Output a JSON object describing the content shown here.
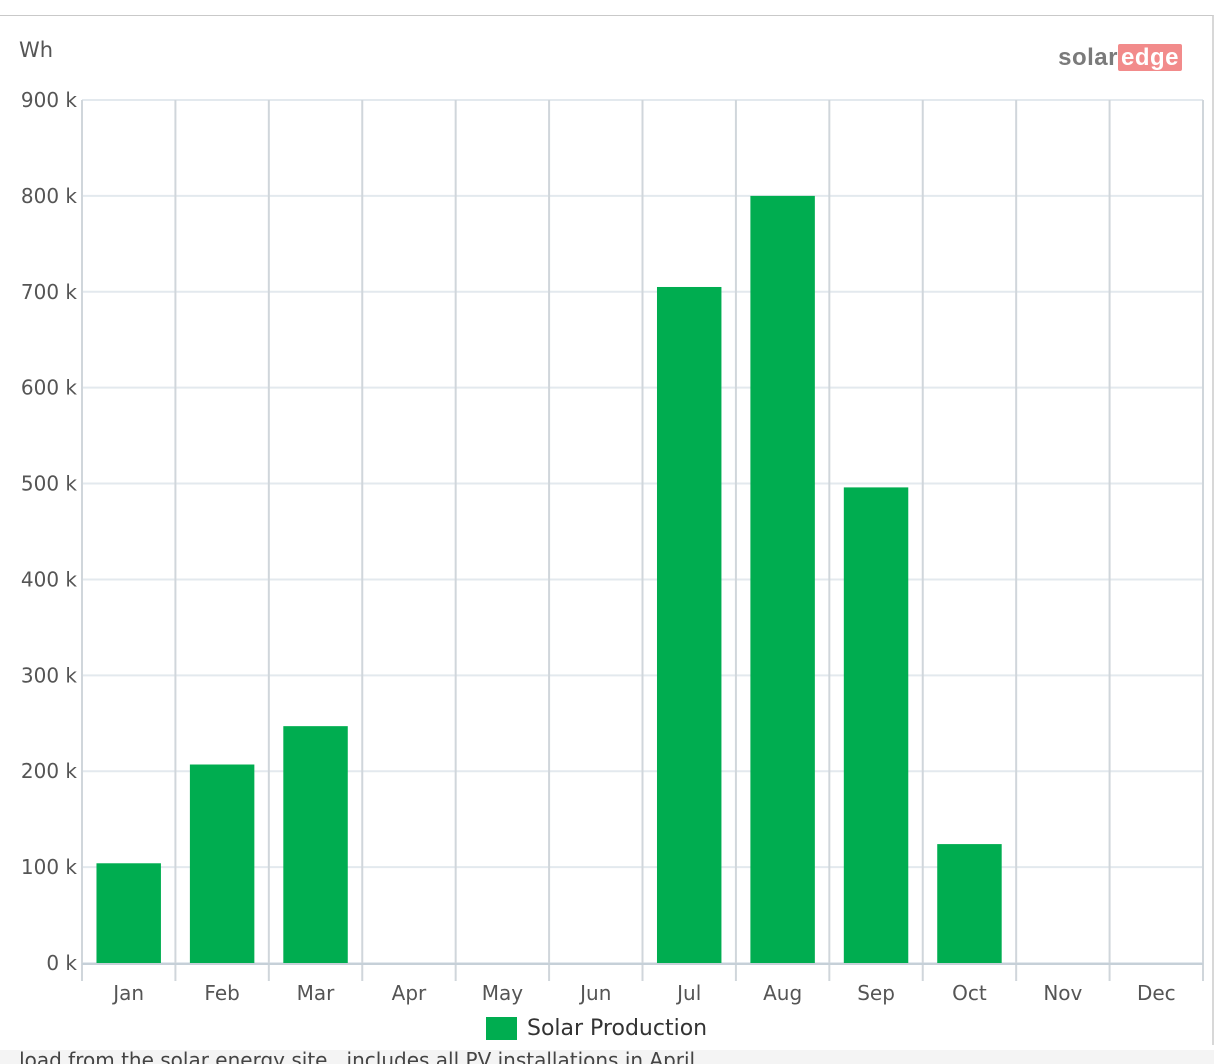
{
  "chart_data": {
    "type": "bar",
    "ylabel": "Wh",
    "categories": [
      "Jan",
      "Feb",
      "Mar",
      "Apr",
      "May",
      "Jun",
      "Jul",
      "Aug",
      "Sep",
      "Oct",
      "Nov",
      "Dec"
    ],
    "series": [
      {
        "name": "Solar Production",
        "values": [
          104000,
          207000,
          247000,
          0,
          0,
          0,
          705000,
          800000,
          496000,
          124000,
          0,
          0
        ],
        "color": "#00ad50"
      }
    ],
    "ylim": [
      0,
      900000
    ],
    "yticks": [
      0,
      100000,
      200000,
      300000,
      400000,
      500000,
      600000,
      700000,
      800000,
      900000
    ],
    "ytick_labels": [
      "0 k",
      "100 k",
      "200 k",
      "300 k",
      "400 k",
      "500 k",
      "600 k",
      "700 k",
      "800 k",
      "900 k"
    ],
    "grid": true,
    "legend": "bottom-center"
  },
  "brand": {
    "part1": "solar",
    "part2": "edge"
  },
  "footer": {
    "text": "...load from the solar energy site...includes all PV installations in April. ..."
  }
}
